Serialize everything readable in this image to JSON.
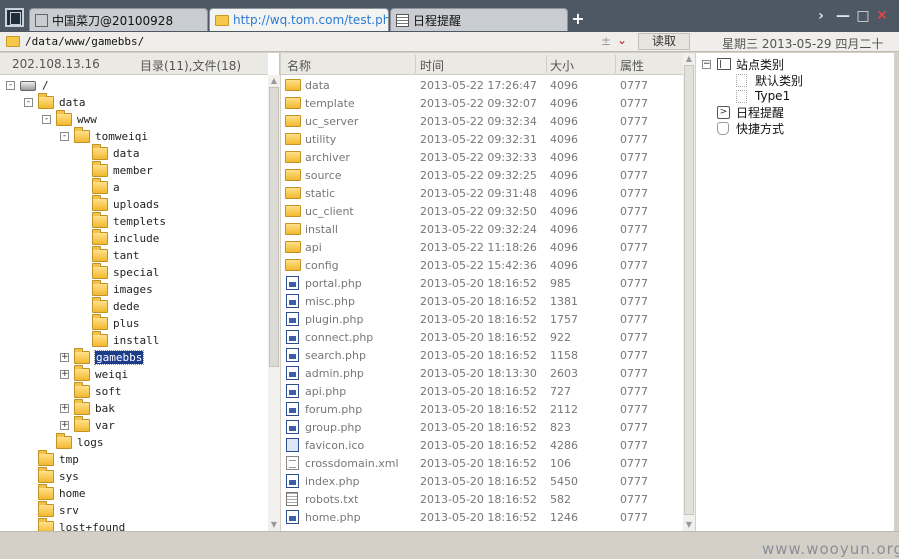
{
  "tabs": [
    {
      "label": "中国菜刀@20100928"
    },
    {
      "label": "http://wq.tom.com/test.php"
    },
    {
      "label": "日程提醒"
    }
  ],
  "tab_add": "+",
  "window_controls": {
    "minimize": "—",
    "maximize": "□",
    "close": "✕",
    "nav": "›"
  },
  "address": {
    "path": "/data/www/gamebbs/",
    "pm": "±",
    "dropdown": "⌄",
    "read_label": "读取",
    "date": "星期三 2013-05-29 四月二十"
  },
  "tree": {
    "ip": "202.108.13.16",
    "count": "目录(11),文件(18)",
    "nodes": [
      {
        "label": "/",
        "depth": 0,
        "toggle": "-",
        "icon": "drive"
      },
      {
        "label": "data",
        "depth": 1,
        "toggle": "-",
        "icon": "folder"
      },
      {
        "label": "www",
        "depth": 2,
        "toggle": "-",
        "icon": "folder"
      },
      {
        "label": "tomweiqi",
        "depth": 3,
        "toggle": "-",
        "icon": "folder"
      },
      {
        "label": "data",
        "depth": 4,
        "toggle": "",
        "icon": "folder"
      },
      {
        "label": "member",
        "depth": 4,
        "toggle": "",
        "icon": "folder"
      },
      {
        "label": "a",
        "depth": 4,
        "toggle": "",
        "icon": "folder"
      },
      {
        "label": "uploads",
        "depth": 4,
        "toggle": "",
        "icon": "folder"
      },
      {
        "label": "templets",
        "depth": 4,
        "toggle": "",
        "icon": "folder"
      },
      {
        "label": "include",
        "depth": 4,
        "toggle": "",
        "icon": "folder"
      },
      {
        "label": "tant",
        "depth": 4,
        "toggle": "",
        "icon": "folder"
      },
      {
        "label": "special",
        "depth": 4,
        "toggle": "",
        "icon": "folder"
      },
      {
        "label": "images",
        "depth": 4,
        "toggle": "",
        "icon": "folder"
      },
      {
        "label": "dede",
        "depth": 4,
        "toggle": "",
        "icon": "folder"
      },
      {
        "label": "plus",
        "depth": 4,
        "toggle": "",
        "icon": "folder"
      },
      {
        "label": "install",
        "depth": 4,
        "toggle": "",
        "icon": "folder"
      },
      {
        "label": "gamebbs",
        "depth": 3,
        "toggle": "+",
        "icon": "folder",
        "selected": true
      },
      {
        "label": "weiqi",
        "depth": 3,
        "toggle": "+",
        "icon": "folder"
      },
      {
        "label": "soft",
        "depth": 3,
        "toggle": "",
        "icon": "folder"
      },
      {
        "label": "bak",
        "depth": 3,
        "toggle": "+",
        "icon": "folder"
      },
      {
        "label": "var",
        "depth": 3,
        "toggle": "+",
        "icon": "folder"
      },
      {
        "label": "logs",
        "depth": 2,
        "toggle": "",
        "icon": "folder"
      },
      {
        "label": "tmp",
        "depth": 1,
        "toggle": "",
        "icon": "folder"
      },
      {
        "label": "sys",
        "depth": 1,
        "toggle": "",
        "icon": "folder"
      },
      {
        "label": "home",
        "depth": 1,
        "toggle": "",
        "icon": "folder"
      },
      {
        "label": "srv",
        "depth": 1,
        "toggle": "",
        "icon": "folder"
      },
      {
        "label": "lost+found",
        "depth": 1,
        "toggle": "",
        "icon": "folder"
      }
    ]
  },
  "files": {
    "columns": {
      "name": "名称",
      "time": "时间",
      "size": "大小",
      "perm": "属性"
    },
    "rows": [
      {
        "name": "data",
        "time": "2013-05-22 17:26:47",
        "size": "4096",
        "perm": "0777",
        "type": "dir"
      },
      {
        "name": "template",
        "time": "2013-05-22 09:32:07",
        "size": "4096",
        "perm": "0777",
        "type": "dir"
      },
      {
        "name": "uc_server",
        "time": "2013-05-22 09:32:34",
        "size": "4096",
        "perm": "0777",
        "type": "dir"
      },
      {
        "name": "utility",
        "time": "2013-05-22 09:32:31",
        "size": "4096",
        "perm": "0777",
        "type": "dir"
      },
      {
        "name": "archiver",
        "time": "2013-05-22 09:32:33",
        "size": "4096",
        "perm": "0777",
        "type": "dir"
      },
      {
        "name": "source",
        "time": "2013-05-22 09:32:25",
        "size": "4096",
        "perm": "0777",
        "type": "dir"
      },
      {
        "name": "static",
        "time": "2013-05-22 09:31:48",
        "size": "4096",
        "perm": "0777",
        "type": "dir"
      },
      {
        "name": "uc_client",
        "time": "2013-05-22 09:32:50",
        "size": "4096",
        "perm": "0777",
        "type": "dir"
      },
      {
        "name": "install",
        "time": "2013-05-22 09:32:24",
        "size": "4096",
        "perm": "0777",
        "type": "dir"
      },
      {
        "name": "api",
        "time": "2013-05-22 11:18:26",
        "size": "4096",
        "perm": "0777",
        "type": "dir"
      },
      {
        "name": "config",
        "time": "2013-05-22 15:42:36",
        "size": "4096",
        "perm": "0777",
        "type": "dir"
      },
      {
        "name": "portal.php",
        "time": "2013-05-20 18:16:52",
        "size": "985",
        "perm": "0777",
        "type": "php"
      },
      {
        "name": "misc.php",
        "time": "2013-05-20 18:16:52",
        "size": "1381",
        "perm": "0777",
        "type": "php"
      },
      {
        "name": "plugin.php",
        "time": "2013-05-20 18:16:52",
        "size": "1757",
        "perm": "0777",
        "type": "php"
      },
      {
        "name": "connect.php",
        "time": "2013-05-20 18:16:52",
        "size": "922",
        "perm": "0777",
        "type": "php"
      },
      {
        "name": "search.php",
        "time": "2013-05-20 18:16:52",
        "size": "1158",
        "perm": "0777",
        "type": "php"
      },
      {
        "name": "admin.php",
        "time": "2013-05-20 18:13:30",
        "size": "2603",
        "perm": "0777",
        "type": "php"
      },
      {
        "name": "api.php",
        "time": "2013-05-20 18:16:52",
        "size": "727",
        "perm": "0777",
        "type": "php"
      },
      {
        "name": "forum.php",
        "time": "2013-05-20 18:16:52",
        "size": "2112",
        "perm": "0777",
        "type": "php"
      },
      {
        "name": "group.php",
        "time": "2013-05-20 18:16:52",
        "size": "823",
        "perm": "0777",
        "type": "php"
      },
      {
        "name": "favicon.ico",
        "time": "2013-05-20 18:16:52",
        "size": "4286",
        "perm": "0777",
        "type": "ico"
      },
      {
        "name": "crossdomain.xml",
        "time": "2013-05-20 18:16:52",
        "size": "106",
        "perm": "0777",
        "type": "xml"
      },
      {
        "name": "index.php",
        "time": "2013-05-20 18:16:52",
        "size": "5450",
        "perm": "0777",
        "type": "php"
      },
      {
        "name": "robots.txt",
        "time": "2013-05-20 18:16:52",
        "size": "582",
        "perm": "0777",
        "type": "txt"
      },
      {
        "name": "home.php",
        "time": "2013-05-20 18:16:52",
        "size": "1246",
        "perm": "0777",
        "type": "php"
      }
    ]
  },
  "right_tree": {
    "site_category": "站点类别",
    "default_category": "默认类别",
    "type1": "Type1",
    "schedule": "日程提醒",
    "shortcuts": "快捷方式"
  },
  "watermark": "www.wooyun.org"
}
